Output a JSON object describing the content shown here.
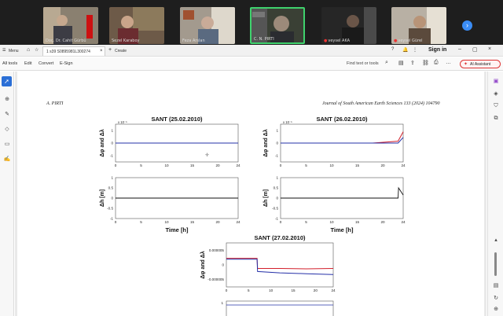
{
  "participants": [
    {
      "name": "Doç. Dr. Cahit Gürbü",
      "muted": false
    },
    {
      "name": "Sezel Karaboy",
      "muted": false
    },
    {
      "name": "Feza Arslan",
      "muted": false
    },
    {
      "name": "C. N. PIRTI",
      "muted": false
    },
    {
      "name": "veysel AKA",
      "muted": true
    },
    {
      "name": "veysel Gürel",
      "muted": true
    }
  ],
  "app": {
    "menu_label": "Menu",
    "tab_title": "1 s39 S0895981L300274",
    "new_tab_label": "Create",
    "sign_in": "Sign in",
    "menus": [
      "All tools",
      "Edit",
      "Convert",
      "E-Sign"
    ],
    "find_placeholder": "Find text or tools",
    "ai_button": "AI Assistant"
  },
  "page": {
    "header_left": "A. PIRTI",
    "header_right": "Journal of South American Earth Sciences 133 (2024) 104790"
  },
  "figure": {
    "xlabel": "Time [h]",
    "plots": [
      {
        "title": "SANT (25.02.2010)",
        "ylabel_top": "Δφ and Δλ",
        "ylabel_bottom": "Δh [m]",
        "exp": "x 10⁻⁵"
      },
      {
        "title": "SANT (26.02.2010)",
        "ylabel_top": "Δφ and Δλ",
        "ylabel_bottom": "Δh [m]",
        "exp": "x 10⁻⁵"
      },
      {
        "title": "SANT (27.02.2010)",
        "ylabel_top": "Δφ and Δλ"
      }
    ],
    "xticks": [
      "0",
      "5",
      "10",
      "15",
      "20",
      "24"
    ],
    "yticks_top": [
      "1",
      "0",
      "-1"
    ],
    "yticks_bottom": [
      "1",
      "0.5",
      "0",
      "-0.5",
      "-1"
    ],
    "yticks_third": [
      "0.000005",
      "0",
      "-0.000005"
    ],
    "colors": {
      "red": "#d21e2a",
      "blue": "#2530a8"
    }
  },
  "chart_data": [
    {
      "type": "line",
      "title": "SANT (25.02.2010)",
      "ylabel": "Δφ and Δλ",
      "xlim": [
        0,
        24
      ],
      "ylim": [
        -1,
        1
      ],
      "series": [
        {
          "values_x": [
            0,
            6,
            12,
            18,
            24
          ],
          "values": [
            0,
            0,
            0,
            0,
            0
          ]
        },
        {
          "values_x": [
            0,
            6,
            12,
            18,
            24
          ],
          "values": [
            0,
            0,
            0,
            0,
            0
          ]
        }
      ]
    },
    {
      "type": "line",
      "title": "",
      "ylabel": "Δh [m]",
      "xlabel": "Time [h]",
      "xlim": [
        0,
        24
      ],
      "ylim": [
        -1,
        1
      ],
      "series": [
        {
          "values_x": [
            0,
            6,
            12,
            18,
            24
          ],
          "values": [
            0,
            0,
            0,
            0,
            0
          ]
        }
      ]
    },
    {
      "type": "line",
      "title": "SANT (26.02.2010)",
      "ylabel": "Δφ and Δλ",
      "xlim": [
        0,
        24
      ],
      "ylim": [
        -1,
        1
      ],
      "series": [
        {
          "values_x": [
            0,
            6,
            12,
            18,
            23,
            24
          ],
          "values": [
            0,
            0,
            0,
            0,
            0.1,
            0.6
          ]
        },
        {
          "values_x": [
            0,
            6,
            12,
            18,
            23,
            24
          ],
          "values": [
            0,
            0,
            0,
            0,
            0,
            0.3
          ]
        }
      ]
    },
    {
      "type": "line",
      "title": "",
      "ylabel": "Δh [m]",
      "xlabel": "Time [h]",
      "xlim": [
        0,
        24
      ],
      "ylim": [
        -1,
        1
      ],
      "series": [
        {
          "values_x": [
            0,
            6,
            12,
            18,
            23,
            23.1,
            24
          ],
          "values": [
            0,
            0,
            0,
            0,
            0,
            0.5,
            0.15
          ]
        }
      ]
    },
    {
      "type": "line",
      "title": "SANT (27.02.2010)",
      "ylabel": "Δφ and Δλ",
      "xlim": [
        0,
        24
      ],
      "ylim": [
        -5e-06,
        5e-06
      ],
      "series": [
        {
          "values_x": [
            0,
            6.9,
            7,
            12,
            18,
            24
          ],
          "values": [
            1.5e-06,
            1.5e-06,
            -8e-07,
            -8e-07,
            -9e-07,
            -8e-07
          ]
        },
        {
          "values_x": [
            0,
            6.9,
            7,
            12,
            18,
            24
          ],
          "values": [
            1.3e-06,
            1.3e-06,
            -1.5e-06,
            -1.8e-06,
            -2e-06,
            -2.2e-06
          ]
        }
      ]
    }
  ]
}
